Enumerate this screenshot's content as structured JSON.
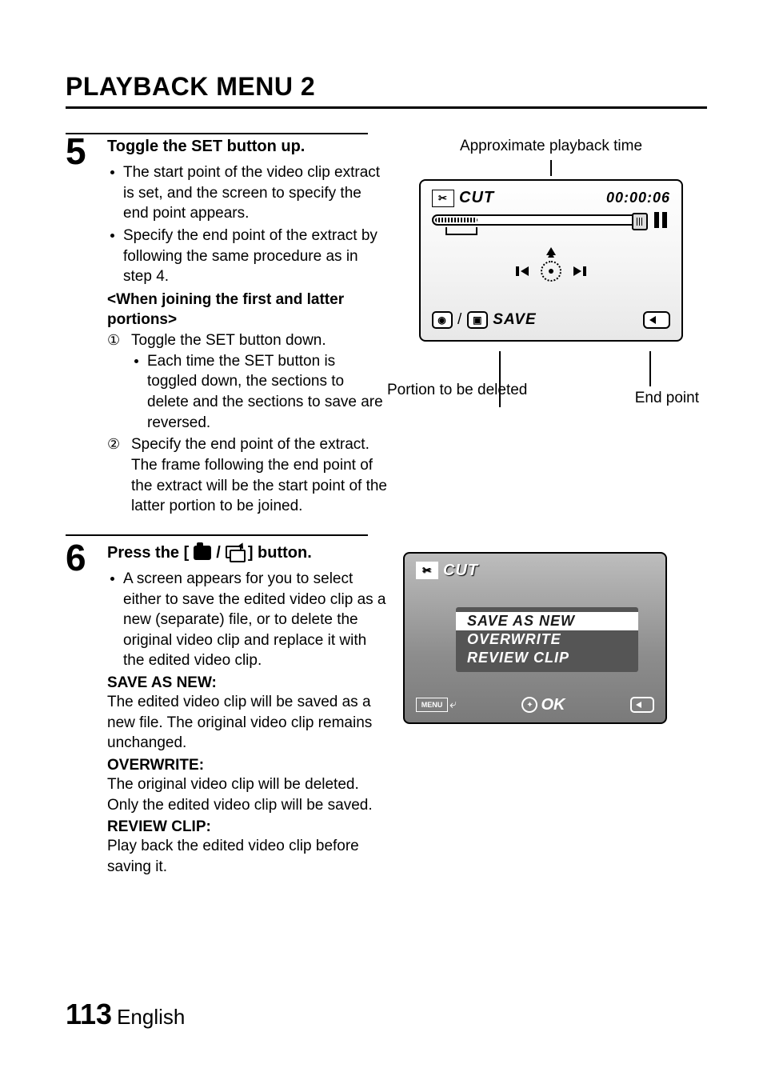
{
  "title": "PLAYBACK MENU 2",
  "step5": {
    "num": "5",
    "title": "Toggle the SET button up.",
    "bullets": [
      "The start point of the video clip extract is set, and the screen to specify the end point appears.",
      "Specify the end point of the extract by following the same procedure as in step 4."
    ],
    "join_heading": "<When joining the first and latter portions>",
    "circled": {
      "c1": "Toggle the SET button down.",
      "c1_sub": "Each time the SET button is toggled down, the sections to delete and the sections to save are reversed.",
      "c2": "Specify the end point of the extract. The frame following the end point of the extract will be the start point of the latter portion to be joined."
    }
  },
  "diagram1": {
    "approx_label": "Approximate playback time",
    "cut": "CUT",
    "time": "00:00:06",
    "save": "SAVE",
    "end_point": "End point",
    "portion": "Portion to be deleted"
  },
  "step6": {
    "num": "6",
    "title_pre": "Press the [",
    "title_post": "] button.",
    "bullet": "A screen appears for you to select either to save the edited video clip as a new (separate) file, or to delete the original video clip and replace it with the edited video clip.",
    "save_as_new_label": "SAVE AS NEW:",
    "save_as_new_desc": "The edited video clip will be saved as a new file. The original video clip remains unchanged.",
    "overwrite_label": "OVERWRITE:",
    "overwrite_desc": "The original video clip will be deleted. Only the edited video clip will be saved.",
    "review_label": "REVIEW CLIP:",
    "review_desc": "Play back the edited video clip before saving it."
  },
  "diagram2": {
    "cut": "CUT",
    "opt1": "SAVE AS NEW",
    "opt2": "OVERWRITE",
    "opt3": "REVIEW CLIP",
    "menu": "MENU",
    "ok": "OK"
  },
  "footer": {
    "page": "113",
    "lang": "English"
  }
}
